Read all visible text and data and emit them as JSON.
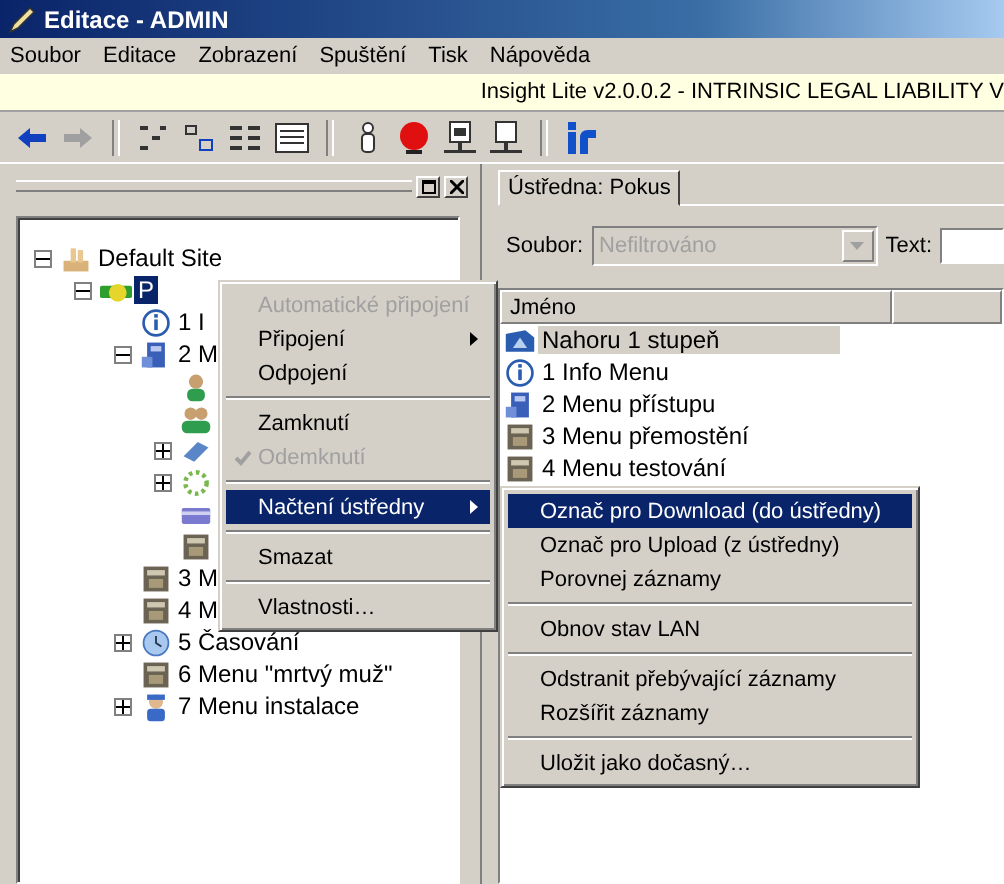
{
  "window": {
    "title": "Editace - ADMIN"
  },
  "menu_bar": [
    "Soubor",
    "Editace",
    "Zobrazení",
    "Spuštění",
    "Tisk",
    "Nápověda"
  ],
  "banner": "Insight Lite v2.0.0.2 - INTRINSIC LEGAL LIABILITY V",
  "toolbar": [
    {
      "kind": "back",
      "disabled": false
    },
    {
      "kind": "forward",
      "disabled": true
    },
    {
      "kind": "sep"
    },
    {
      "kind": "tree"
    },
    {
      "kind": "small"
    },
    {
      "kind": "list"
    },
    {
      "kind": "details"
    },
    {
      "kind": "sep"
    },
    {
      "kind": "person"
    },
    {
      "kind": "alarm"
    },
    {
      "kind": "netpanel"
    },
    {
      "kind": "netbox"
    },
    {
      "kind": "sep"
    },
    {
      "kind": "logo"
    }
  ],
  "tree": [
    {
      "label": "Default Site",
      "kind": "site",
      "expanded": true,
      "selected": false,
      "children": [
        {
          "label": "P",
          "kind": "panel",
          "expanded": true,
          "selected": true,
          "children": [
            {
              "label": "1 I",
              "kind": "info",
              "selected": false
            },
            {
              "label": "2 M",
              "kind": "keypad",
              "expanded": true,
              "selected": false,
              "children": [
                {
                  "kind": "person"
                },
                {
                  "kind": "people"
                },
                {
                  "kind": "book",
                  "expanded": false
                },
                {
                  "kind": "ring",
                  "expanded": false
                },
                {
                  "kind": "card"
                },
                {
                  "kind": "box"
                }
              ]
            },
            {
              "label": "3 M",
              "kind": "box",
              "selected": false
            },
            {
              "label": "4 M",
              "kind": "box",
              "selected": false
            },
            {
              "label": "5 Časování",
              "kind": "clock",
              "expanded": false,
              "selected": false
            },
            {
              "label": "6 Menu \"mrtvý muž\"",
              "kind": "box",
              "selected": false
            },
            {
              "label": "7 Menu instalace",
              "kind": "installer",
              "expanded": false,
              "selected": false
            }
          ]
        }
      ]
    }
  ],
  "tab": {
    "label": "Ústředna: Pokus",
    "selected": true
  },
  "filter": {
    "label": "Soubor:",
    "value": "Nefiltrováno",
    "disabled": true,
    "text_label": "Text:"
  },
  "list": {
    "columns": [
      "Jméno"
    ],
    "rows": [
      {
        "label": "Nahoru 1 stupeň",
        "kind": "up",
        "selected": true
      },
      {
        "label": "1 Info Menu",
        "kind": "info",
        "selected": false
      },
      {
        "label": "2 Menu přístupu",
        "kind": "keypad",
        "selected": false
      },
      {
        "label": "3 Menu přemostění",
        "kind": "box",
        "selected": false
      },
      {
        "label": "4 Menu testování",
        "kind": "box",
        "selected": false
      }
    ]
  },
  "context_menu": [
    {
      "kind": "item",
      "label": "Automatické připojení",
      "disabled": true,
      "checked": false,
      "submenu": false,
      "selected": false
    },
    {
      "kind": "item",
      "label": "Připojení",
      "disabled": false,
      "checked": false,
      "submenu": true,
      "selected": false
    },
    {
      "kind": "item",
      "label": "Odpojení",
      "disabled": false,
      "checked": false,
      "submenu": false,
      "selected": false
    },
    {
      "kind": "separator"
    },
    {
      "kind": "item",
      "label": "Zamknutí",
      "disabled": false,
      "checked": false,
      "submenu": false,
      "selected": false
    },
    {
      "kind": "item",
      "label": "Odemknutí",
      "disabled": true,
      "checked": true,
      "submenu": false,
      "selected": false
    },
    {
      "kind": "separator"
    },
    {
      "kind": "item",
      "label": "Načtení ústředny",
      "disabled": false,
      "checked": false,
      "submenu": true,
      "selected": true
    },
    {
      "kind": "separator"
    },
    {
      "kind": "item",
      "label": "Smazat",
      "disabled": false,
      "checked": false,
      "submenu": false,
      "selected": false
    },
    {
      "kind": "separator"
    },
    {
      "kind": "item",
      "label": "Vlastnosti…",
      "disabled": false,
      "checked": false,
      "submenu": false,
      "selected": false
    }
  ],
  "submenu": [
    {
      "kind": "item",
      "label": "Označ pro Download (do ústředny)",
      "disabled": false,
      "checked": false,
      "submenu": false,
      "selected": true
    },
    {
      "kind": "item",
      "label": "Označ pro Upload (z ústředny)",
      "disabled": false,
      "checked": false,
      "submenu": false,
      "selected": false
    },
    {
      "kind": "item",
      "label": "Porovnej záznamy",
      "disabled": false,
      "checked": false,
      "submenu": false,
      "selected": false
    },
    {
      "kind": "separator"
    },
    {
      "kind": "item",
      "label": "Obnov stav LAN",
      "disabled": false,
      "checked": false,
      "submenu": false,
      "selected": false
    },
    {
      "kind": "separator"
    },
    {
      "kind": "item",
      "label": "Odstranit přebývající záznamy",
      "disabled": false,
      "checked": false,
      "submenu": false,
      "selected": false
    },
    {
      "kind": "item",
      "label": "Rozšířit záznamy",
      "disabled": false,
      "checked": false,
      "submenu": false,
      "selected": false
    },
    {
      "kind": "separator"
    },
    {
      "kind": "item",
      "label": "Uložit jako dočasný…",
      "disabled": false,
      "checked": false,
      "submenu": false,
      "selected": false
    }
  ]
}
